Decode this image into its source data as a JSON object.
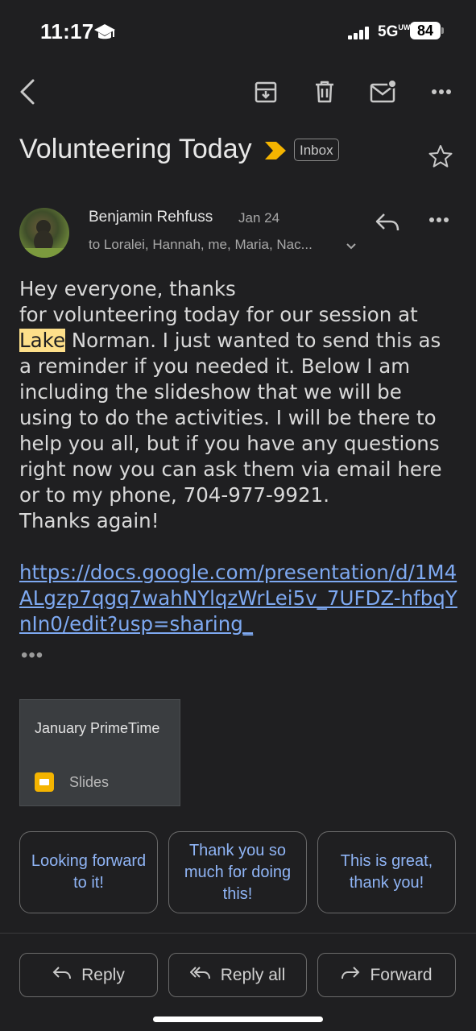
{
  "status_bar": {
    "time": "11:17",
    "network": "5G",
    "network_suffix": "UW",
    "battery": "84"
  },
  "toolbar": {
    "back_icon": "back-arrow-icon",
    "archive_icon": "archive-icon",
    "delete_icon": "trash-icon",
    "mark_unread_icon": "mail-unread-icon",
    "more_icon": "more-horizontal-icon"
  },
  "email": {
    "subject": "Volunteering Today",
    "label": "Inbox",
    "sender": "Benjamin Rehfuss",
    "date": "Jan 24",
    "recipients": "to Loralei, Hannah, me, Maria, Nac...",
    "body_line1": "Hey everyone, thanks\nfor volunteering today for our session at\n",
    "body_highlight": "Lake",
    "body_rest": " Norman. I just wanted to send this as\na reminder if you needed it. Below I am\nincluding the slideshow that we will be\nusing to do the activities. I will be there to\nhelp you all, but if you have any questions\nright now you can ask them via email here\nor to my phone, 704-977-9921.\nThanks again!",
    "link": "https://docs.google.com/presentation/d/1M4ALgzp7qgq7wahNYlqzWrLei5v_7UFDZ-hfbqYnIn0/edit?usp=sharing_",
    "trimmed": "•••"
  },
  "attachment": {
    "title": "January PrimeTime",
    "type": "Slides"
  },
  "smart_replies": [
    "Looking forward to it!",
    "Thank you so much for doing this!",
    "This is great, thank you!"
  ],
  "actions": {
    "reply": "Reply",
    "reply_all": "Reply all",
    "forward": "Forward"
  },
  "colors": {
    "background": "#1f1f21",
    "link": "#7ea9f1",
    "highlight": "#fddf8a",
    "importance": "#f4b400"
  }
}
